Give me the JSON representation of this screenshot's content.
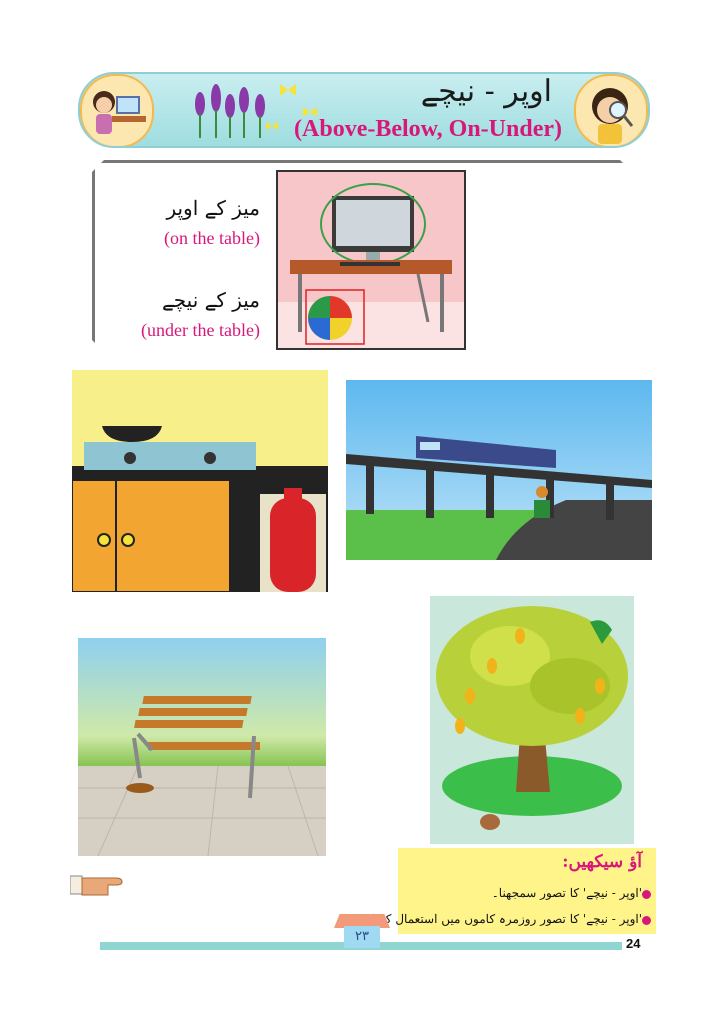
{
  "header": {
    "title_urdu": "اوپر - نیچے",
    "title_english": "(Above-Below, On-Under)"
  },
  "example": {
    "on_urdu": "میز کے اوپر",
    "on_english": "(on the table)",
    "under_urdu": "میز کے نیچے",
    "under_english": "(under the table)"
  },
  "learning": {
    "title": "آؤ سیکھیں:",
    "items": [
      "'اوپر - نیچے' کا تصور سمجھنا۔",
      "'اوپر - نیچے' کا تصور روزمرہ کاموں میں استعمال کرنا۔"
    ]
  },
  "footer": {
    "urdu_page_number": "۲۳",
    "page_number": "24"
  }
}
